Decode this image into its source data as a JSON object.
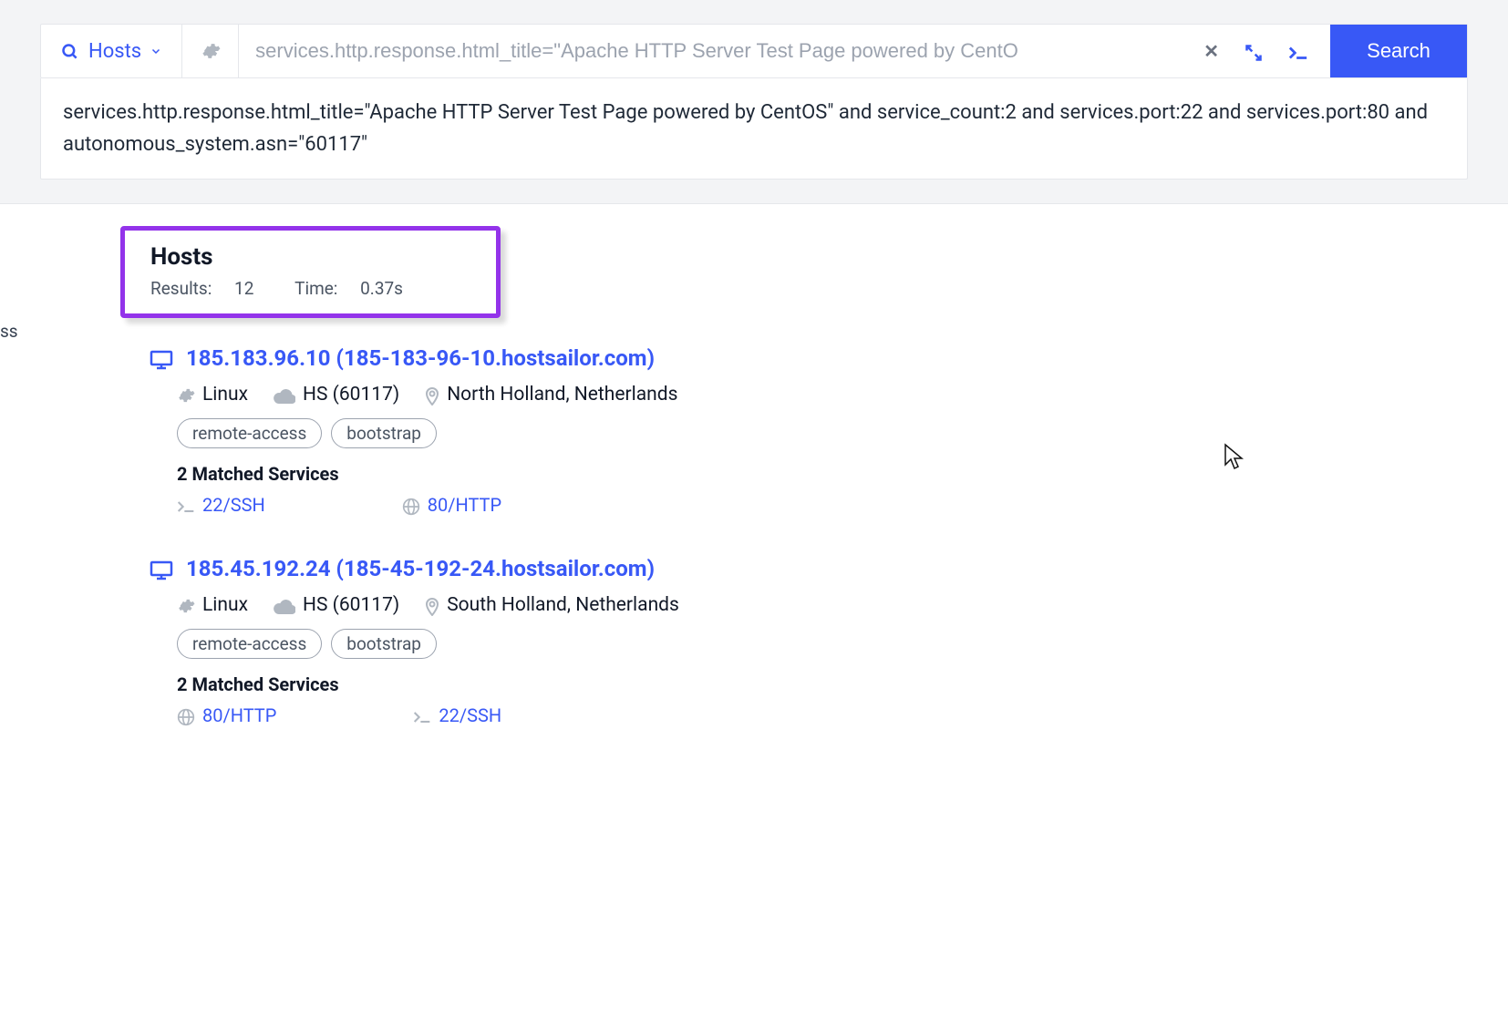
{
  "search": {
    "mode_label": "Hosts",
    "input_placeholder": "services.http.response.html_title=\"Apache HTTP Server Test Page powered by CentO",
    "full_query": "services.http.response.html_title=\"Apache HTTP Server Test Page powered by CentOS\" and service_count:2 and services.port:22 and services.port:80 and autonomous_system.asn=\"60117\"",
    "search_button": "Search"
  },
  "left_nav_fragment": "ss",
  "summary": {
    "heading": "Hosts",
    "results_label": "Results:",
    "results_count": "12",
    "time_label": "Time:",
    "time_value": "0.37s"
  },
  "results": [
    {
      "ip": "185.183.96.10",
      "hostname": "(185-183-96-10.hostsailor.com)",
      "os": "Linux",
      "asn": "HS (60117)",
      "location": "North Holland, Netherlands",
      "tags": [
        "remote-access",
        "bootstrap"
      ],
      "matched_label": "2 Matched Services",
      "services": [
        {
          "icon": "terminal",
          "label": "22/SSH"
        },
        {
          "icon": "globe",
          "label": "80/HTTP"
        }
      ]
    },
    {
      "ip": "185.45.192.24",
      "hostname": "(185-45-192-24.hostsailor.com)",
      "os": "Linux",
      "asn": "HS (60117)",
      "location": "South Holland, Netherlands",
      "tags": [
        "remote-access",
        "bootstrap"
      ],
      "matched_label": "2 Matched Services",
      "services": [
        {
          "icon": "globe",
          "label": "80/HTTP"
        },
        {
          "icon": "terminal",
          "label": "22/SSH"
        }
      ]
    }
  ]
}
